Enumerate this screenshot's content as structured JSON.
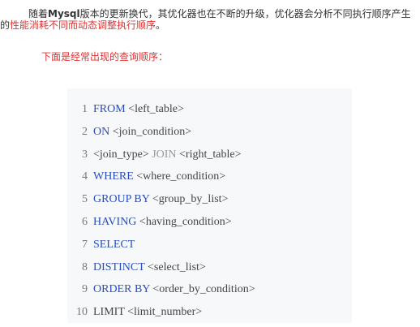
{
  "intro": {
    "text_part1": "随着",
    "text_bold": "Mysql",
    "text_part2": "版本的更新换代，其优化器也在不断的升级，优化器会分析不同执行顺序产生的",
    "text_highlight": "性能消耗不同而动态调整执行顺序",
    "text_end": "。"
  },
  "subtitle": "下面是经常出现的查询顺序：",
  "code": {
    "lines": [
      {
        "num": "1",
        "kw": "FROM",
        "rest": " <left_table>"
      },
      {
        "num": "2",
        "kw": "ON",
        "rest": " <join_condition>"
      },
      {
        "num": "3",
        "pre": "<join_type>",
        "kw": " JOIN",
        "rest": " <right_table>"
      },
      {
        "num": "4",
        "kw": "WHERE",
        "rest": " <where_condition>"
      },
      {
        "num": "5",
        "kw": "GROUP BY",
        "rest": " <group_by_list>"
      },
      {
        "num": "6",
        "kw": "HAVING",
        "rest": " <having_condition>"
      },
      {
        "num": "7",
        "kw": "SELECT",
        "rest": ""
      },
      {
        "num": "8",
        "kw": "DISTINCT",
        "rest": " <select_list>"
      },
      {
        "num": "9",
        "kw": "ORDER BY",
        "rest": " <order_by_condition>"
      },
      {
        "num": "10",
        "kw": "LIMIT",
        "rest": " <limit_number>"
      }
    ]
  },
  "colors": {
    "highlight": "#e23131",
    "keyword": "#2a4dbb",
    "code_background": "#f6f8fa"
  }
}
